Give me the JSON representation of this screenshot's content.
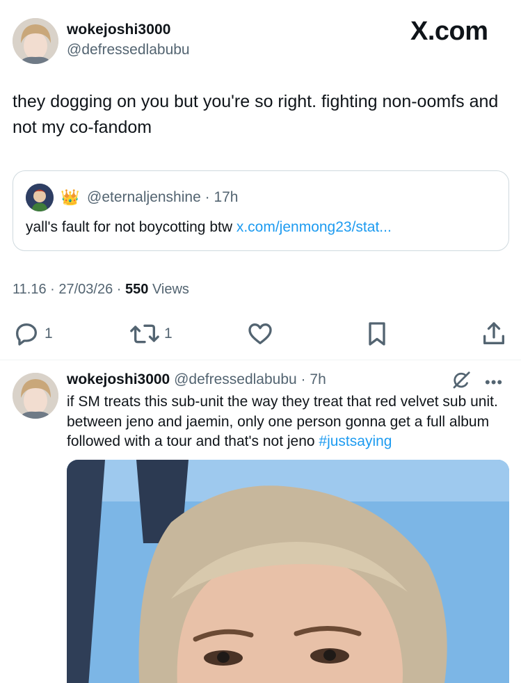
{
  "main_tweet": {
    "display_name": "wokejoshi3000",
    "handle": "@defressedlabubu",
    "site_logo": "X.com",
    "text": "they dogging on you but you're so right. fighting non-oomfs and not my co-fandom",
    "quoted": {
      "badge_emoji": "👑",
      "handle": "@eternaljenshine",
      "separator": "·",
      "age": "17h",
      "text": "yall's fault for not boycotting btw",
      "link_text": "x.com/jenmong23/stat..."
    },
    "meta": {
      "time": "11.16",
      "date": "27/03/26",
      "views_count": "550",
      "views_label": "Views"
    },
    "actions": {
      "reply_count": "1",
      "retweet_count": "1"
    }
  },
  "reply_tweet": {
    "display_name": "wokejoshi3000",
    "handle": "@defressedlabubu",
    "separator": "·",
    "age": "7h",
    "more_label": "•••",
    "text": "if SM treats this sub-unit the way they treat that red velvet sub unit. between jeno and jaemin, only one person gonna get a full album followed with a tour and that's not jeno ",
    "hashtag": "#justsaying"
  },
  "colors": {
    "text_primary": "#0f1419",
    "text_secondary": "#536471",
    "link": "#1d9bf0",
    "border": "#cfd9de"
  },
  "icons": [
    "reply-icon",
    "retweet-icon",
    "like-icon",
    "bookmark-icon",
    "share-icon",
    "grok-icon",
    "more-icon"
  ]
}
